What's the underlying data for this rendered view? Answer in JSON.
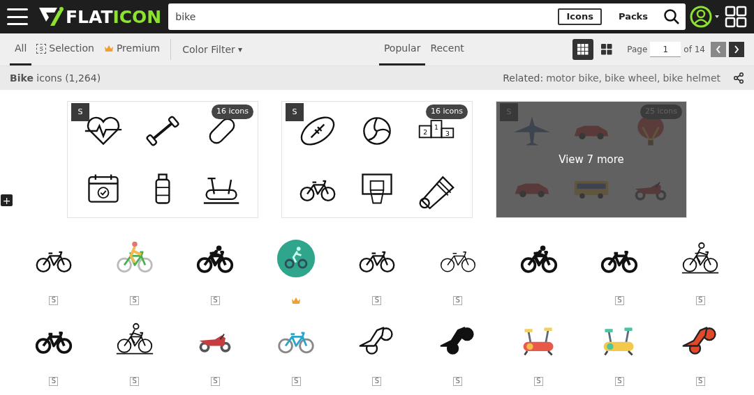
{
  "header": {
    "logo": {
      "part1": "FLAT",
      "part2": "ICON"
    },
    "search": {
      "value": "bike"
    },
    "search_types": [
      {
        "label": "Icons",
        "selected": true
      },
      {
        "label": "Packs",
        "selected": false
      }
    ]
  },
  "filters": [
    {
      "label": "All",
      "kind": "plain",
      "selected": true
    },
    {
      "label": "Selection",
      "kind": "selection",
      "mark": "s",
      "selected": false
    },
    {
      "label": "Premium",
      "kind": "premium",
      "selected": false
    }
  ],
  "color_filter": {
    "label": "Color Filter",
    "caret": "▾"
  },
  "sort_tabs": [
    {
      "label": "Popular",
      "selected": true
    },
    {
      "label": "Recent",
      "selected": false
    }
  ],
  "view_modes": [
    {
      "kind": "small",
      "selected": true
    },
    {
      "kind": "large",
      "selected": false
    }
  ],
  "pagination": {
    "label": "Page",
    "value": "1",
    "total": "of 14",
    "prev_disabled": true
  },
  "results": {
    "title": "**Bike** icons (1,264)",
    "related_label": "Related:",
    "related": [
      "motor bike,",
      "bike wheel,",
      "bike helmet"
    ]
  },
  "packs": [
    {
      "selection_mark": "S",
      "count": "16 icons",
      "icons": [
        {
          "kind": "heartbeat"
        },
        {
          "kind": "dumbbell"
        },
        {
          "kind": "pill"
        },
        {
          "kind": "calendar"
        },
        {
          "kind": "bottle"
        },
        {
          "kind": "exercise-outline"
        }
      ]
    },
    {
      "selection_mark": "S",
      "count": "16 icons",
      "icons": [
        {
          "kind": "football"
        },
        {
          "kind": "volleyball"
        },
        {
          "kind": "podium",
          "labels": [
            "2",
            "1",
            "3"
          ]
        },
        {
          "kind": "bike-outline"
        },
        {
          "kind": "basketball"
        },
        {
          "kind": "shuttlecock"
        }
      ]
    },
    {
      "selection_mark": "S",
      "count": "25 icons",
      "overlay": "View 7 more",
      "icons": [
        {
          "kind": "airplane"
        },
        {
          "kind": "car"
        },
        {
          "kind": "balloon"
        },
        {
          "kind": "car"
        },
        {
          "kind": "bus"
        },
        {
          "kind": "motorbike"
        }
      ]
    }
  ],
  "add_button": "+",
  "icons": [
    {
      "kind": "bike-outline",
      "premium": false,
      "mark": "S"
    },
    {
      "kind": "cyclist-color",
      "premium": false,
      "mark": "S"
    },
    {
      "kind": "cyclist-solid",
      "premium": false,
      "mark": "S"
    },
    {
      "kind": "cyclist-circle",
      "premium": true
    },
    {
      "kind": "bike-outline",
      "premium": false,
      "mark": "S"
    },
    {
      "kind": "bike-thin",
      "premium": false,
      "mark": "S"
    },
    {
      "kind": "cyclist-solid",
      "premium": false
    },
    {
      "kind": "bike-bold",
      "premium": false,
      "mark": "S"
    },
    {
      "kind": "cyclist-line",
      "premium": false,
      "mark": "S"
    },
    {
      "kind": "bike-bold",
      "premium": false,
      "mark": "S"
    },
    {
      "kind": "cyclist-line",
      "premium": false,
      "mark": "S"
    },
    {
      "kind": "motorbike",
      "premium": false,
      "mark": "S"
    },
    {
      "kind": "bike-color",
      "premium": false,
      "mark": "S"
    },
    {
      "kind": "stunt-outline",
      "premium": false,
      "mark": "S"
    },
    {
      "kind": "stunt-solid",
      "premium": false,
      "mark": "S"
    },
    {
      "kind": "exercise-red",
      "premium": false,
      "mark": "S"
    },
    {
      "kind": "exercise-yellow",
      "premium": false,
      "mark": "S"
    },
    {
      "kind": "stunt-red",
      "premium": false,
      "mark": "S"
    }
  ]
}
